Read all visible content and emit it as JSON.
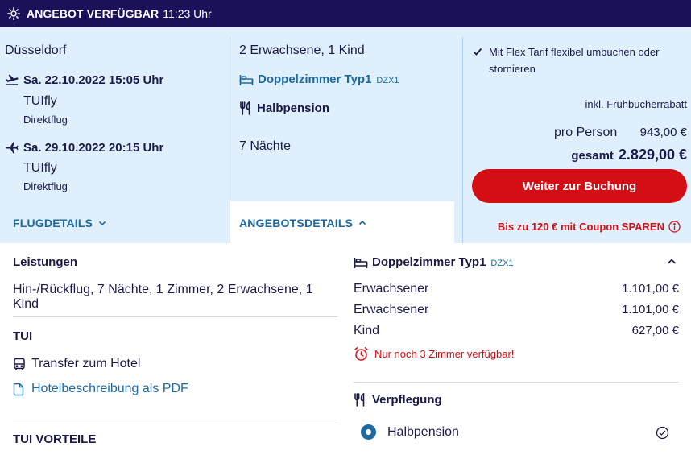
{
  "banner": {
    "label": "ANGEBOT VERFÜGBAR",
    "time": "11:23 Uhr",
    "icon": "sun-icon"
  },
  "flights": {
    "departure_city": "Düsseldorf",
    "outbound": {
      "date": "Sa. 22.10.2022 15:05 Uhr",
      "airline": "TUIfly",
      "type": "Direktflug",
      "icon": "plane-departure-icon"
    },
    "return": {
      "date": "Sa. 29.10.2022 20:15 Uhr",
      "airline": "TUIfly",
      "type": "Direktflug",
      "icon": "plane-arrival-icon"
    },
    "details_link": "FLUGDETAILS"
  },
  "offer": {
    "travellers": "2 Erwachsene, 1 Kind",
    "room_name": "Doppelzimmer Typ1",
    "room_code": "DZX1",
    "board": "Halbpension",
    "nights": "7 Nächte",
    "details_link": "ANGEBOTSDETAILS"
  },
  "pricing": {
    "flex_text": "Mit Flex Tarif flexibel umbuchen oder stornieren",
    "early_booking": "inkl. Frühbucherrabatt",
    "per_person_label": "pro Person",
    "per_person_value": "943,00 €",
    "total_label": "gesamt",
    "total_value": "2.829,00 €",
    "cta_label": "Weiter zur Buchung",
    "coupon_text": "Bis zu 120 € mit Coupon SPAREN"
  },
  "details": {
    "services_heading": "Leistungen",
    "services_text": "Hin-/Rückflug, 7 Nächte, 1 Zimmer, 2 Erwachsene, 1 Kind",
    "tui_heading": "TUI",
    "transfer": "Transfer zum Hotel",
    "hotel_pdf": "Hotelbeschreibung als PDF",
    "advantages_heading": "TUI VORTEILE"
  },
  "room_breakdown": {
    "room_name": "Doppelzimmer Typ1",
    "room_code": "DZX1",
    "lines": [
      {
        "label": "Erwachsener",
        "amount": "1.101,00 €"
      },
      {
        "label": "Erwachsener",
        "amount": "1.101,00 €"
      },
      {
        "label": "Kind",
        "amount": "627,00 €"
      }
    ],
    "availability_alert": "Nur noch 3 Zimmer verfügbar!",
    "board_heading": "Verpflegung",
    "board_option": "Halbpension"
  },
  "colors": {
    "banner_bg": "#1a115a",
    "summary_bg": "#dff0fc",
    "accent_blue": "#1e6aa0",
    "cta_red": "#d40e14",
    "text_dark": "#1a1a48"
  }
}
